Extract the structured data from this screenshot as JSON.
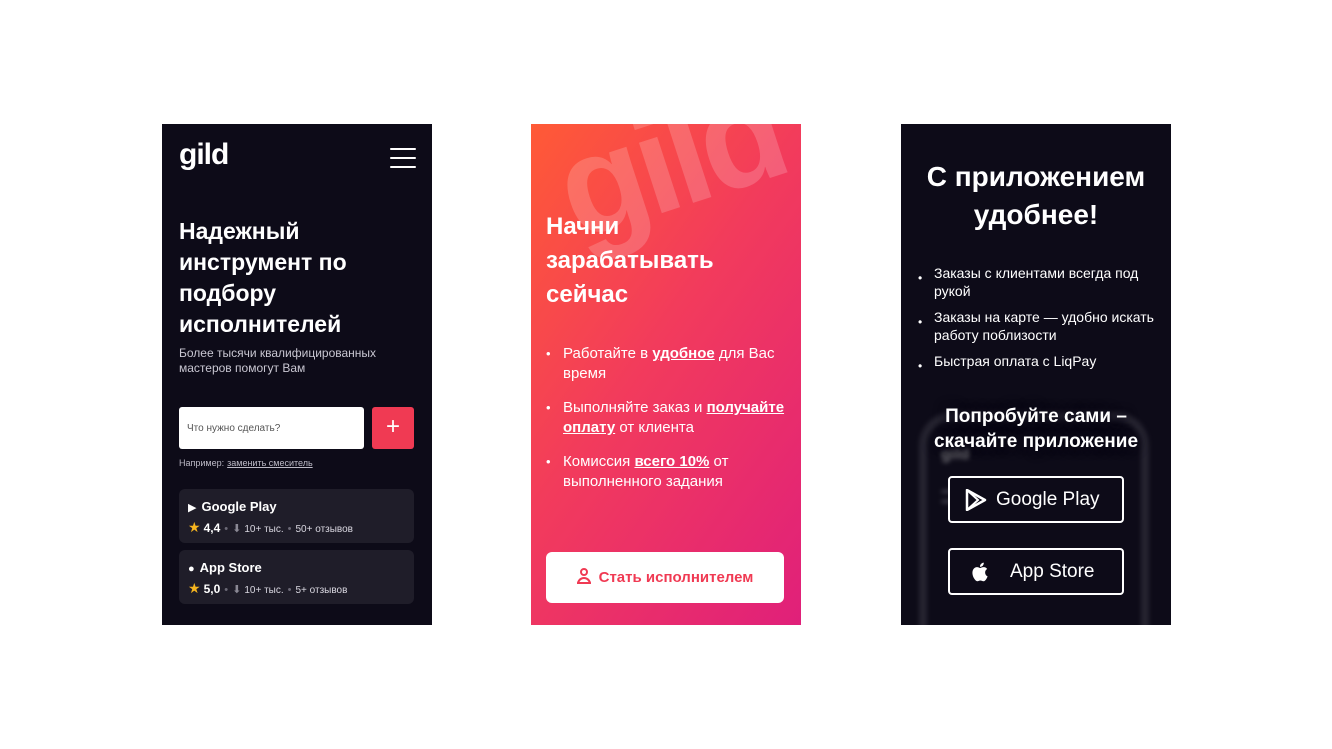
{
  "screen1": {
    "logo": "gild",
    "headline": "Надежный инструмент по подбору исполнителей",
    "subtitle": "Более тысячи квалифицированных мастеров помогут Вам",
    "search_placeholder": "Что нужно сделать?",
    "add_label": "+",
    "example_label": "Например:",
    "example_link": "заменить смеситель",
    "stores": [
      {
        "name": "Google Play",
        "rating": "4,4",
        "downloads": "10+ тыс.",
        "reviews": "50+ отзывов"
      },
      {
        "name": "App Store",
        "rating": "5,0",
        "downloads": "10+ тыс.",
        "reviews": "5+ отзывов"
      }
    ]
  },
  "screen2": {
    "bg_logo": "gild",
    "headline": "Начни зарабатывать сейчас",
    "bullets": [
      {
        "pre": "Работайте в ",
        "bold": "удобное",
        "post": " для Вас время"
      },
      {
        "pre": "Выполняйте заказ и ",
        "bold": "получайте оплату",
        "post": " от клиента"
      },
      {
        "pre": "Комиссия ",
        "bold": "всего 10%",
        "post": " от выполненного задания"
      }
    ],
    "cta_label": "Стать исполнителем"
  },
  "screen3": {
    "headline": "С приложением удобнее!",
    "bullets": [
      "Заказы с клиентами всегда под рукой",
      "Заказы на карте — удобно искать работу поблизости",
      "Быстрая оплата с LiqPay"
    ],
    "subheadline": "Попробуйте сами – скачайте приложение",
    "google_play_label": "Google Play",
    "app_store_label": "App Store",
    "phone_logo": "gild"
  },
  "colors": {
    "dark_bg": "#0d0b18",
    "accent": "#f03a53",
    "gradient_start": "#ff5a36",
    "gradient_end": "#e0207a",
    "star": "#f6b51f"
  }
}
